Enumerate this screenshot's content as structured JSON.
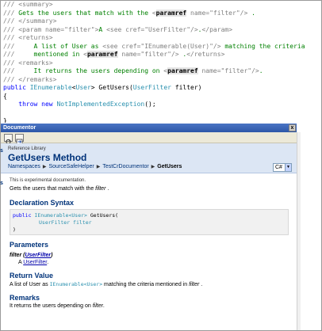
{
  "editor": {
    "lines": [
      [
        {
          "t": "/// ",
          "c": "gray"
        },
        {
          "t": "<summary>",
          "c": "gray"
        }
      ],
      [
        {
          "t": "/// ",
          "c": "gray"
        },
        {
          "t": "Gets the users that match with the ",
          "c": "green"
        },
        {
          "t": "<",
          "c": "gray"
        },
        {
          "t": "paramref",
          "c": "ref"
        },
        {
          "t": " name=\"filter\"/>",
          "c": "gray"
        },
        {
          "t": " .",
          "c": "green"
        }
      ],
      [
        {
          "t": "/// ",
          "c": "gray"
        },
        {
          "t": "</summary>",
          "c": "gray"
        }
      ],
      [
        {
          "t": "/// ",
          "c": "gray"
        },
        {
          "t": "<param name=\"filter\">",
          "c": "gray"
        },
        {
          "t": "A ",
          "c": "green"
        },
        {
          "t": "<see cref=\"UserFilter\"/>",
          "c": "gray"
        },
        {
          "t": ".",
          "c": "green"
        },
        {
          "t": "</param>",
          "c": "gray"
        }
      ],
      [
        {
          "t": "/// ",
          "c": "gray"
        },
        {
          "t": "<returns>",
          "c": "gray"
        }
      ],
      [
        {
          "t": "///     ",
          "c": "gray"
        },
        {
          "t": "A list of User as ",
          "c": "green"
        },
        {
          "t": "<see cref=\"IEnumerable(User)\"/>",
          "c": "gray"
        },
        {
          "t": " matching the criteria",
          "c": "green"
        }
      ],
      [
        {
          "t": "///     ",
          "c": "gray"
        },
        {
          "t": "mentioned in ",
          "c": "green"
        },
        {
          "t": "<",
          "c": "gray"
        },
        {
          "t": "paramref",
          "c": "ref"
        },
        {
          "t": " name=\"filter\"/>",
          "c": "gray"
        },
        {
          "t": " .",
          "c": "green"
        },
        {
          "t": "</returns>",
          "c": "gray"
        }
      ],
      [
        {
          "t": "/// ",
          "c": "gray"
        },
        {
          "t": "<remarks>",
          "c": "gray"
        }
      ],
      [
        {
          "t": "///     ",
          "c": "gray"
        },
        {
          "t": "It returns the users depending on ",
          "c": "green"
        },
        {
          "t": "<",
          "c": "gray"
        },
        {
          "t": "paramref",
          "c": "ref"
        },
        {
          "t": " name=\"filter\"/>",
          "c": "gray"
        },
        {
          "t": ".",
          "c": "green"
        }
      ],
      [
        {
          "t": "/// ",
          "c": "gray"
        },
        {
          "t": "</remarks>",
          "c": "gray"
        }
      ],
      [
        {
          "t": "public ",
          "c": "blue"
        },
        {
          "t": "IEnumerable",
          "c": "type"
        },
        {
          "t": "<",
          "c": "black"
        },
        {
          "t": "User",
          "c": "type"
        },
        {
          "t": "> GetUsers(",
          "c": "black"
        },
        {
          "t": "UserFilter",
          "c": "type"
        },
        {
          "t": " filter)",
          "c": "black"
        }
      ],
      [
        {
          "t": "{",
          "c": "black"
        }
      ],
      [
        {
          "t": "    throw new ",
          "c": "blue"
        },
        {
          "t": "NotImplementedException",
          "c": "type"
        },
        {
          "t": "();",
          "c": "black"
        }
      ],
      [
        {
          "t": "",
          "c": "black"
        }
      ],
      [
        {
          "t": "}",
          "c": "black"
        }
      ]
    ]
  },
  "documentor": {
    "title": "Documentor",
    "close_label": "x",
    "toolbar": [
      "refresh-icon",
      "export-icon"
    ],
    "reference_library": "Reference Library",
    "method_title": "GetUsers Method",
    "breadcrumbs": {
      "items": [
        "Namespaces",
        "SourceSafeHelper",
        "TestCrDocumentor"
      ],
      "current": "GetUsers"
    },
    "language": "C#",
    "experimental_note": "This is experimental documentation.",
    "summary_prefix": "Gets the users that match with the ",
    "summary_ref": "filter",
    "summary_suffix": " .",
    "declaration_heading": "Declaration Syntax",
    "declaration": {
      "line1": {
        "kw": "public ",
        "type1": "IEnumerable<User>",
        "rest": " GetUsers("
      },
      "line2": {
        "type": "UserFilter",
        "rest": " filter"
      },
      "line3": ")"
    },
    "parameters_heading": "Parameters",
    "param_name": "filter",
    "param_type": "UserFilter",
    "param_desc_prefix": "A ",
    "param_desc_link": "UserFilter",
    "param_desc_suffix": ".",
    "return_heading": "Return Value",
    "return_prefix": "A list of User as ",
    "return_code": "IEnumerable<User>",
    "return_middle": " matching the criteria mentioned in ",
    "return_ref": "filter",
    "return_suffix": " .",
    "remarks_heading": "Remarks",
    "remarks_prefix": "It returns the users depending on ",
    "remarks_ref": "filter",
    "remarks_suffix": ".",
    "edge_marks": [
      "s",
      "s"
    ]
  }
}
